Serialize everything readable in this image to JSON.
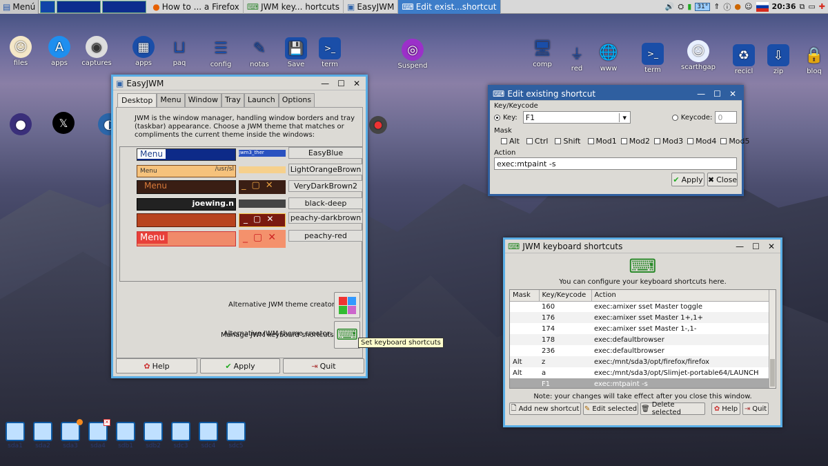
{
  "taskbar": {
    "menu_label": "Menú",
    "tasks": [
      {
        "label": "How to ... a Firefox",
        "icon": "firefox-icon"
      },
      {
        "label": "JWM key... hortcuts",
        "icon": "keyboard-icon"
      },
      {
        "label": "EasyJWM",
        "icon": "window-icon"
      },
      {
        "label": "Edit exist...shortcut",
        "icon": "keyboard-icon",
        "active": true
      }
    ],
    "tray_temp": "31°",
    "clock": "20:36"
  },
  "desktop_icons": [
    {
      "label": "files"
    },
    {
      "label": "apps"
    },
    {
      "label": "captures"
    },
    {
      "label": "apps"
    },
    {
      "label": "paq"
    },
    {
      "label": "config"
    },
    {
      "label": "notas"
    },
    {
      "label": "Save"
    },
    {
      "label": "term"
    },
    {
      "label": "Suspend"
    },
    {
      "label": "comp"
    },
    {
      "label": "red"
    },
    {
      "label": "www"
    },
    {
      "label": "term"
    },
    {
      "label": "scarthgap"
    },
    {
      "label": "recicl"
    },
    {
      "label": "zip"
    },
    {
      "label": "bloq"
    }
  ],
  "easyjwm": {
    "title": "EasyJWM",
    "tabs": [
      "Desktop",
      "Menu",
      "Window",
      "Tray",
      "Launch",
      "Options"
    ],
    "description": "JWM is the window manager, handling window borders and tray (taskbar) appearance. Choose a JWM theme that matches or compliments the current theme inside the windows:",
    "themes": [
      {
        "name": "EasyBlue",
        "preview_menu": "Menu",
        "preview_extra": "jwm3_ther"
      },
      {
        "name": "LightOrangeBrown",
        "preview_menu": "Menu",
        "preview_extra": "/usr/sl"
      },
      {
        "name": "VeryDarkBrown2",
        "preview_menu": "Menu",
        "preview_extra": ""
      },
      {
        "name": "black-deep",
        "preview_menu": "",
        "preview_extra": "joewing.n"
      },
      {
        "name": "peachy-darkbrown",
        "preview_menu": "",
        "preview_extra": ""
      },
      {
        "name": "peachy-red",
        "preview_menu": "Menu",
        "preview_extra": ""
      }
    ],
    "alt_creator_label": "Alternative JWM theme creator:",
    "manage_shortcuts_label": "Manage JWM keyboard shortcuts:",
    "tooltip": "Set keyboard shortcuts",
    "buttons": {
      "help": "Help",
      "apply": "Apply",
      "quit": "Quit"
    }
  },
  "edit_dialog": {
    "title": "Edit existing shortcut",
    "keycode_section": "Key/Keycode",
    "key_label": "Key:",
    "key_value": "F1",
    "keycode_label": "Keycode:",
    "keycode_value": "0",
    "mask_section": "Mask",
    "masks": [
      "Alt",
      "Ctrl",
      "Shift",
      "Mod1",
      "Mod2",
      "Mod3",
      "Mod4",
      "Mod5"
    ],
    "action_section": "Action",
    "action_value": "exec:mtpaint -s",
    "apply": "Apply",
    "close": "Close"
  },
  "shortcuts_window": {
    "title": "JWM keyboard shortcuts",
    "intro": "You can configure your keyboard shortcuts here.",
    "columns": [
      "Mask",
      "Key/Keycode",
      "Action"
    ],
    "rows": [
      {
        "mask": "",
        "key": "160",
        "action": "exec:amixer sset Master toggle"
      },
      {
        "mask": "",
        "key": "176",
        "action": "exec:amixer sset Master 1+,1+"
      },
      {
        "mask": "",
        "key": "174",
        "action": "exec:amixer sset Master 1-,1-"
      },
      {
        "mask": "",
        "key": "178",
        "action": "exec:defaultbrowser"
      },
      {
        "mask": "",
        "key": "236",
        "action": "exec:defaultbrowser"
      },
      {
        "mask": "Alt",
        "key": "z",
        "action": "exec:/mnt/sda3/opt/firefox/firefox"
      },
      {
        "mask": "Alt",
        "key": "a",
        "action": "exec:/mnt/sda3/opt/Slimjet-portable64/LAUNCH"
      },
      {
        "mask": "",
        "key": "F1",
        "action": "exec:mtpaint -s",
        "selected": true
      }
    ],
    "note": "Note: your changes will take effect after you close this window.",
    "buttons": {
      "add": "Add new shortcut",
      "edit": "Edit selected",
      "delete": "Delete selected",
      "help": "Help",
      "quit": "Quit"
    }
  },
  "drives": [
    {
      "label": "sda1"
    },
    {
      "label": "sda2"
    },
    {
      "label": "sda3"
    },
    {
      "label": "sda4"
    },
    {
      "label": "sdb1"
    },
    {
      "label": "sdb2"
    },
    {
      "label": "sdc3"
    },
    {
      "label": "sdc4"
    },
    {
      "label": "sdc5"
    }
  ]
}
